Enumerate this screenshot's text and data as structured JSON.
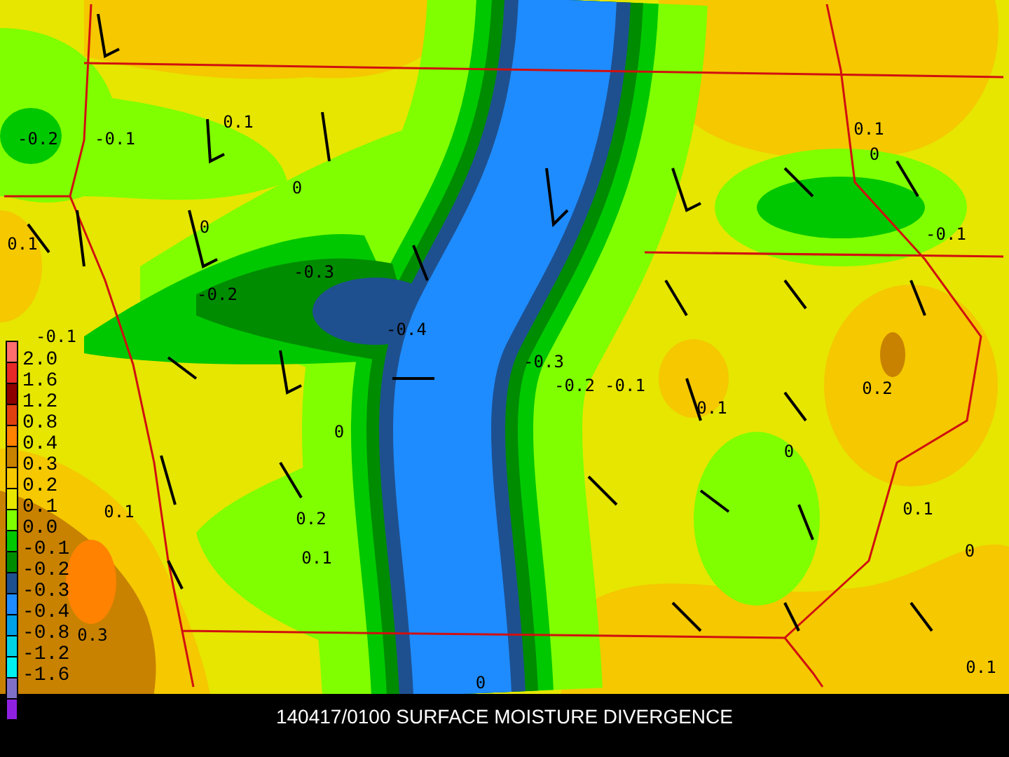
{
  "map": {
    "contour_labels": [
      "-0.2",
      "-0.1",
      "0.1",
      "0.1",
      "0",
      "0",
      "-0.2",
      "-0.3",
      "-0.4",
      "-0.1",
      "0",
      "0.1",
      "0.2",
      "0.1",
      "0.3",
      "0",
      "-0.3",
      "-0.2",
      "-0.1",
      "0.1",
      "0",
      "-0.1",
      "0.1",
      "0.2",
      "0",
      "0.1",
      "0",
      "0.1"
    ]
  },
  "legend": {
    "swatches": [
      {
        "color": "#ff6e6e"
      },
      {
        "color": "#e62828"
      },
      {
        "color": "#8c0000"
      },
      {
        "color": "#e04010"
      },
      {
        "color": "#ff8200"
      },
      {
        "color": "#c88200"
      },
      {
        "color": "#f5c800"
      },
      {
        "color": "#e6e600"
      },
      {
        "color": "#80ff00"
      },
      {
        "color": "#00c800"
      },
      {
        "color": "#008c00"
      },
      {
        "color": "#1e5090"
      },
      {
        "color": "#1e8cff"
      },
      {
        "color": "#00a0e6"
      },
      {
        "color": "#00d2e6"
      },
      {
        "color": "#00f0f0"
      },
      {
        "color": "#8070c8"
      },
      {
        "color": "#9020e0"
      }
    ],
    "labels": [
      "2.0",
      "1.6",
      "1.2",
      "0.8",
      "0.4",
      "0.3",
      "0.2",
      "0.1",
      "0.0",
      "-0.1",
      "-0.2",
      "-0.3",
      "-0.4",
      "-0.8",
      "-1.2",
      "-1.6"
    ]
  },
  "caption": "140417/0100 SURFACE MOISTURE DIVERGENCE"
}
